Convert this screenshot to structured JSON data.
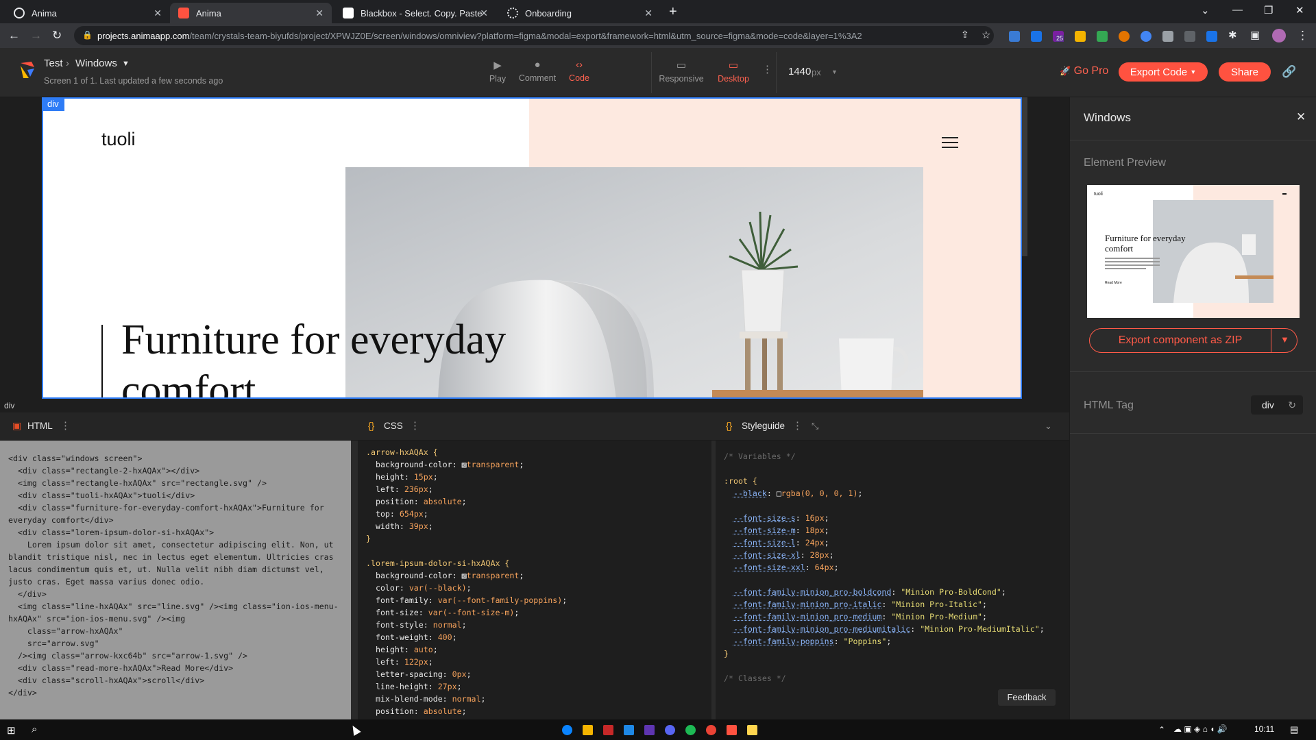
{
  "browser": {
    "tabs": [
      {
        "title": "Anima",
        "active": false
      },
      {
        "title": "Anima",
        "active": true
      },
      {
        "title": "Blackbox - Select. Copy. Paste &",
        "active": false
      },
      {
        "title": "Onboarding",
        "active": false
      }
    ],
    "url_host": "projects.animaapp.com",
    "url_path": "/team/crystals-team-biyufds/project/XPWJZ0E/screen/windows/omniview?platform=figma&modal=export&framework=html&utm_source=figma&mode=code&layer=1%3A2",
    "extension_badge": "25"
  },
  "anima": {
    "project": "Test",
    "screen": "Windows",
    "subline": "Screen 1 of 1. Last updated a few seconds ago",
    "modes": {
      "play": "Play",
      "comment": "Comment",
      "code": "Code"
    },
    "views": {
      "responsive": "Responsive",
      "desktop": "Desktop"
    },
    "width_value": "1440",
    "width_unit": "px",
    "go_pro": "Go Pro",
    "export_code": "Export Code",
    "share": "Share",
    "accent": "#ff5240"
  },
  "canvas": {
    "frame_tag": "div",
    "brand": "tuoli",
    "headline": "Furniture for everyday comfort"
  },
  "panel": {
    "title": "Windows",
    "element_preview": "Element Preview",
    "preview_headline": "Furniture for everyday comfort",
    "preview_brand": "tuoli",
    "preview_read_more": "Read More",
    "export_zip": "Export component as ZIP",
    "html_tag_label": "HTML Tag",
    "html_tag_value": "div"
  },
  "code": {
    "breadcrumb": "div",
    "html_label": "HTML",
    "css_label": "CSS",
    "styleguide_label": "Styleguide",
    "html_lines": [
      "<div class=\"windows screen\">",
      "  <div class=\"rectangle-2-hxAQAx\"></div>",
      "  <img class=\"rectangle-hxAQAx\" src=\"rectangle.svg\" />",
      "  <div class=\"tuoli-hxAQAx\">tuoli</div>",
      "  <div class=\"furniture-for-everyday-comfort-hxAQAx\">Furniture for everyday comfort</div>",
      "  <div class=\"lorem-ipsum-dolor-si-hxAQAx\">",
      "    Lorem ipsum dolor sit amet, consectetur adipiscing elit. Non, ut blandit tristique nisl, nec in lectus eget elementum. Ultricies cras lacus condimentum quis et, ut. Nulla velit nibh diam dictumst vel, justo cras. Eget massa varius donec odio.",
      "  </div>",
      "  <img class=\"line-hxAQAx\" src=\"line.svg\" /><img class=\"ion-ios-menu-hxAQAx\" src=\"ion-ios-menu.svg\" /><img",
      "    class=\"arrow-hxAQAx\"",
      "    src=\"arrow.svg\"",
      "  /><img class=\"arrow-kxc64b\" src=\"arrow-1.svg\" />",
      "  <div class=\"read-more-hxAQAx\">Read More</div>",
      "  <div class=\"scroll-hxAQAx\">scroll</div>",
      "</div>"
    ],
    "css_rules": [
      {
        "selector": ".arrow-hxAQAx {",
        "props": [
          [
            "background-color",
            "transparent",
            true
          ],
          [
            "height",
            "15px",
            false
          ],
          [
            "left",
            "236px",
            false
          ],
          [
            "position",
            "absolute",
            false
          ],
          [
            "top",
            "654px",
            false
          ],
          [
            "width",
            "39px",
            false
          ]
        ]
      },
      {
        "selector": ".lorem-ipsum-dolor-si-hxAQAx {",
        "props": [
          [
            "background-color",
            "transparent",
            true
          ],
          [
            "color",
            "var(--black)",
            false
          ],
          [
            "font-family",
            "var(--font-family-poppins)",
            false
          ],
          [
            "font-size",
            "var(--font-size-m)",
            false
          ],
          [
            "font-style",
            "normal",
            false
          ],
          [
            "font-weight",
            "400",
            false
          ],
          [
            "height",
            "auto",
            false
          ],
          [
            "left",
            "122px",
            false
          ],
          [
            "letter-spacing",
            "0px",
            false
          ],
          [
            "line-height",
            "27px",
            false
          ],
          [
            "mix-blend-mode",
            "normal",
            false
          ],
          [
            "position",
            "absolute",
            false
          ]
        ]
      }
    ],
    "styleguide": {
      "vars_comment": "/* Variables */",
      "root": ":root {",
      "black": [
        "--black",
        "rgba(0, 0, 0, 1)"
      ],
      "sizes": [
        [
          "--font-size-s",
          "16px"
        ],
        [
          "--font-size-m",
          "18px"
        ],
        [
          "--font-size-l",
          "24px"
        ],
        [
          "--font-size-xl",
          "28px"
        ],
        [
          "--font-size-xxl",
          "64px"
        ]
      ],
      "families": [
        [
          "--font-family-minion_pro-boldcond",
          "\"Minion Pro-BoldCond\""
        ],
        [
          "--font-family-minion_pro-italic",
          "\"Minion Pro-Italic\""
        ],
        [
          "--font-family-minion_pro-medium",
          "\"Minion Pro-Medium\""
        ],
        [
          "--font-family-minion_pro-mediumitalic",
          "\"Minion Pro-MediumItalic\""
        ],
        [
          "--font-family-poppins",
          "\"Poppins\""
        ]
      ],
      "classes_comment": "/* Classes */"
    },
    "feedback": "Feedback"
  },
  "taskbar": {
    "time": "10:11"
  }
}
